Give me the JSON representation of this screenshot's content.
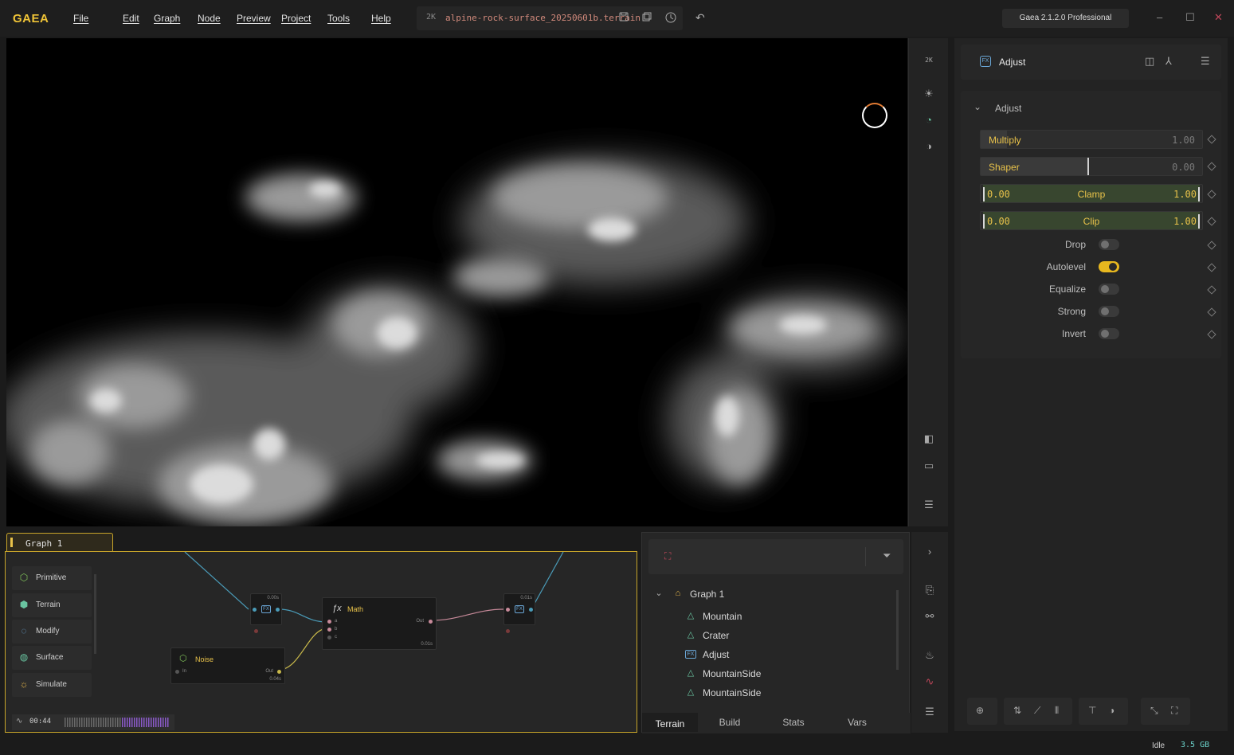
{
  "app": {
    "logo": "GAEA",
    "menu": [
      "File",
      "Edit",
      "Graph",
      "Node",
      "Preview",
      "Project",
      "Tools",
      "Help"
    ],
    "resolution_badge": "2K",
    "file_name": "alpine-rock-surface_20250601b.terrain",
    "version": "Gaea 2.1.2.0 Professional",
    "window_controls": {
      "minimize": "–",
      "maximize": "☐",
      "close": "✕"
    }
  },
  "viewport": {
    "toolbar_resolution": "2K",
    "tools": [
      "sun-icon",
      "color-sphere-icon",
      "contrast-icon",
      "split-view-icon",
      "layout-icon",
      "menu-icon"
    ]
  },
  "properties": {
    "node_title": "Adjust",
    "section_title": "Adjust",
    "multiply": {
      "label": "Multiply",
      "value": "1.00",
      "fraction": 0.12
    },
    "shaper": {
      "label": "Shaper",
      "value": "0.00",
      "fraction": 0.49
    },
    "clamp": {
      "label": "Clamp",
      "min": "0.00",
      "max": "1.00"
    },
    "clip": {
      "label": "Clip",
      "min": "0.00",
      "max": "1.00"
    },
    "toggles": [
      {
        "label": "Drop",
        "on": false
      },
      {
        "label": "Autolevel",
        "on": true
      },
      {
        "label": "Equalize",
        "on": false
      },
      {
        "label": "Strong",
        "on": false
      },
      {
        "label": "Invert",
        "on": false
      }
    ]
  },
  "graph": {
    "tab_label": "Graph 1",
    "palette": [
      {
        "label": "Primitive",
        "icon": "cube-icon",
        "color": "#7fc25a"
      },
      {
        "label": "Terrain",
        "icon": "terrain-icon",
        "color": "#69c4a0"
      },
      {
        "label": "Modify",
        "icon": "modify-icon",
        "color": "#6aa6d6"
      },
      {
        "label": "Surface",
        "icon": "surface-icon",
        "color": "#69c4a0"
      },
      {
        "label": "Simulate",
        "icon": "simulate-icon",
        "color": "#e8b84a"
      }
    ],
    "timeline_time": "00:44",
    "nodes": {
      "math": {
        "title": "Math",
        "ports": [
          "a",
          "b",
          "c"
        ],
        "out": "Out",
        "timing": "0.01s"
      },
      "noise": {
        "title": "Noise",
        "in": "In",
        "out": "Out",
        "timing": "0.04s"
      },
      "fx1": {
        "timing": "0.00s"
      },
      "fx2": {
        "timing": "0.01s"
      }
    }
  },
  "tree": {
    "root": "Graph 1",
    "items": [
      {
        "label": "Mountain",
        "icon": "mountain-icon"
      },
      {
        "label": "Crater",
        "icon": "mountain-icon"
      },
      {
        "label": "Adjust",
        "icon": "fx-icon"
      },
      {
        "label": "MountainSide",
        "icon": "mountain-icon"
      },
      {
        "label": "MountainSide",
        "icon": "mountain-icon"
      }
    ],
    "tabs": [
      "Terrain",
      "Build",
      "Stats",
      "Vars"
    ],
    "active_tab": "Terrain"
  },
  "status": {
    "state": "Idle",
    "memory": "3.5 GB"
  },
  "colors": {
    "accent": "#e8c24a",
    "teal": "#69c4a0",
    "blue": "#6aa6d6",
    "wire_blue": "#4a9bb8",
    "wire_yellow": "#c8b84a",
    "wire_pink": "#c88a9a"
  }
}
